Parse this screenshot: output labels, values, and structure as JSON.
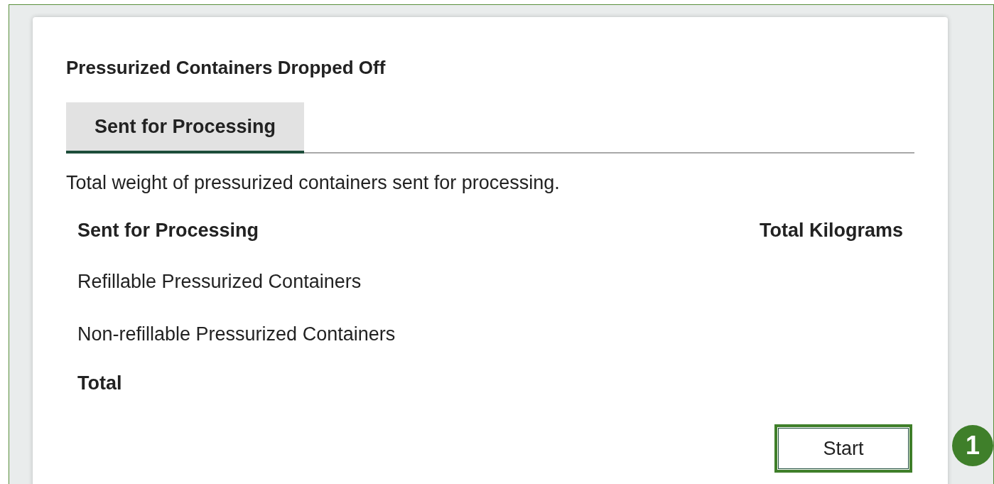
{
  "card": {
    "title": "Pressurized Containers Dropped Off",
    "tabs": [
      {
        "label": "Sent for Processing",
        "selected": true
      }
    ],
    "description": "Total weight of pressurized containers sent for processing.",
    "table": {
      "columns": [
        "Sent for Processing",
        "Total Kilograms"
      ],
      "rows": [
        {
          "label": "Refillable Pressurized Containers",
          "kind": "item"
        },
        {
          "label": "Non-refillable Pressurized Containers",
          "kind": "item"
        },
        {
          "label": "Total",
          "kind": "total"
        }
      ]
    },
    "button": "Start"
  },
  "callout": "1"
}
